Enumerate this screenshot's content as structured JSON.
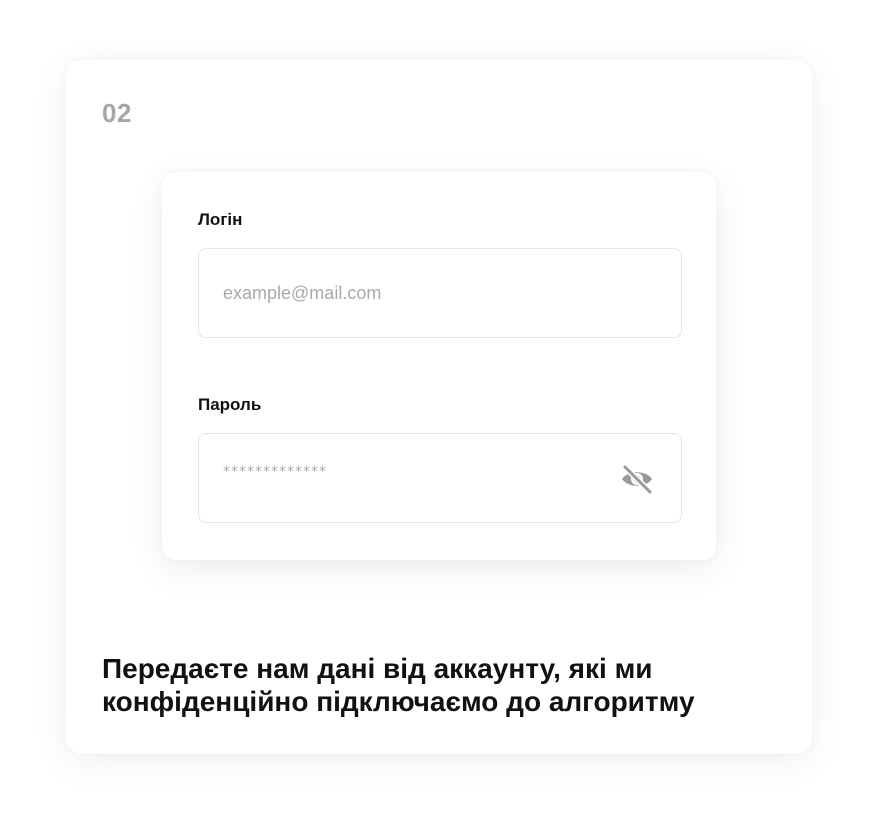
{
  "step": {
    "number": "02"
  },
  "form": {
    "login": {
      "label": "Логін",
      "placeholder": "example@mail.com",
      "value": ""
    },
    "password": {
      "label": "Пароль",
      "masked_value": "*************",
      "toggle_icon": "eye-off-icon"
    }
  },
  "description": {
    "line1": "Передаєте нам дані від аккаунту, які ми",
    "line2": "конфіденційно підключаємо до алгоритму"
  },
  "colors": {
    "step_number": "#a6a6a6",
    "text": "#111111",
    "placeholder": "#a9a9a9",
    "border": "#e6e6e6",
    "icon": "#9a9a9a"
  }
}
